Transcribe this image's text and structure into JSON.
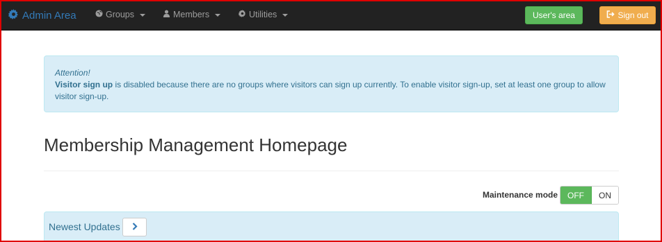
{
  "navbar": {
    "brand": {
      "icon": "gear-icon",
      "label": "Admin Area"
    },
    "menus": [
      {
        "icon": "globe-icon",
        "label": "Groups"
      },
      {
        "icon": "user-icon",
        "label": "Members"
      },
      {
        "icon": "gear-icon",
        "label": "Utilities"
      }
    ],
    "users_area_label": "User's area",
    "sign_out": {
      "icon": "sign-out-icon",
      "label": "Sign out"
    }
  },
  "alert": {
    "heading": "Attention!",
    "bold_text": "Visitor sign up",
    "body": " is disabled because there are no groups where visitors can sign up currently. To enable visitor sign-up, set at least one group to allow visitor sign-up."
  },
  "page": {
    "title": "Membership Management Homepage"
  },
  "maintenance": {
    "label": "Maintenance mode",
    "off_label": "OFF",
    "on_label": "ON",
    "state": "OFF"
  },
  "updates_panel": {
    "title": "Newest Updates",
    "button_icon": "chevron-right-icon"
  },
  "colors": {
    "navbar_bg": "#222222",
    "link_blue": "#337ab7",
    "success_green": "#5cb85c",
    "warning_orange": "#f0ad4e",
    "info_bg": "#d9edf7",
    "info_text": "#31708f",
    "frame_red": "#e00000"
  }
}
